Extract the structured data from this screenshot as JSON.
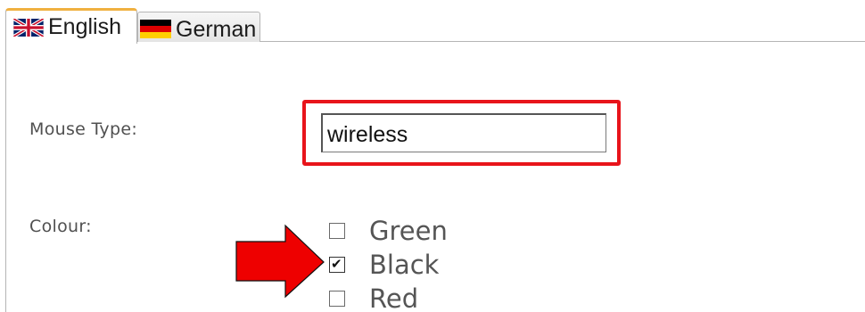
{
  "tabs": [
    {
      "label": "English",
      "flag_icon": "uk-flag-icon",
      "active": true
    },
    {
      "label": "German",
      "flag_icon": "german-flag-icon",
      "active": false
    }
  ],
  "form": {
    "mouse_type": {
      "label": "Mouse Type:",
      "value": "wireless"
    },
    "colour": {
      "label": "Colour:",
      "options": [
        {
          "label": "Green",
          "checked": false
        },
        {
          "label": "Black",
          "checked": true
        },
        {
          "label": "Red",
          "checked": false
        }
      ]
    }
  },
  "annotations": {
    "highlight_color": "#e8141b",
    "arrow_color": "#ee0000"
  }
}
